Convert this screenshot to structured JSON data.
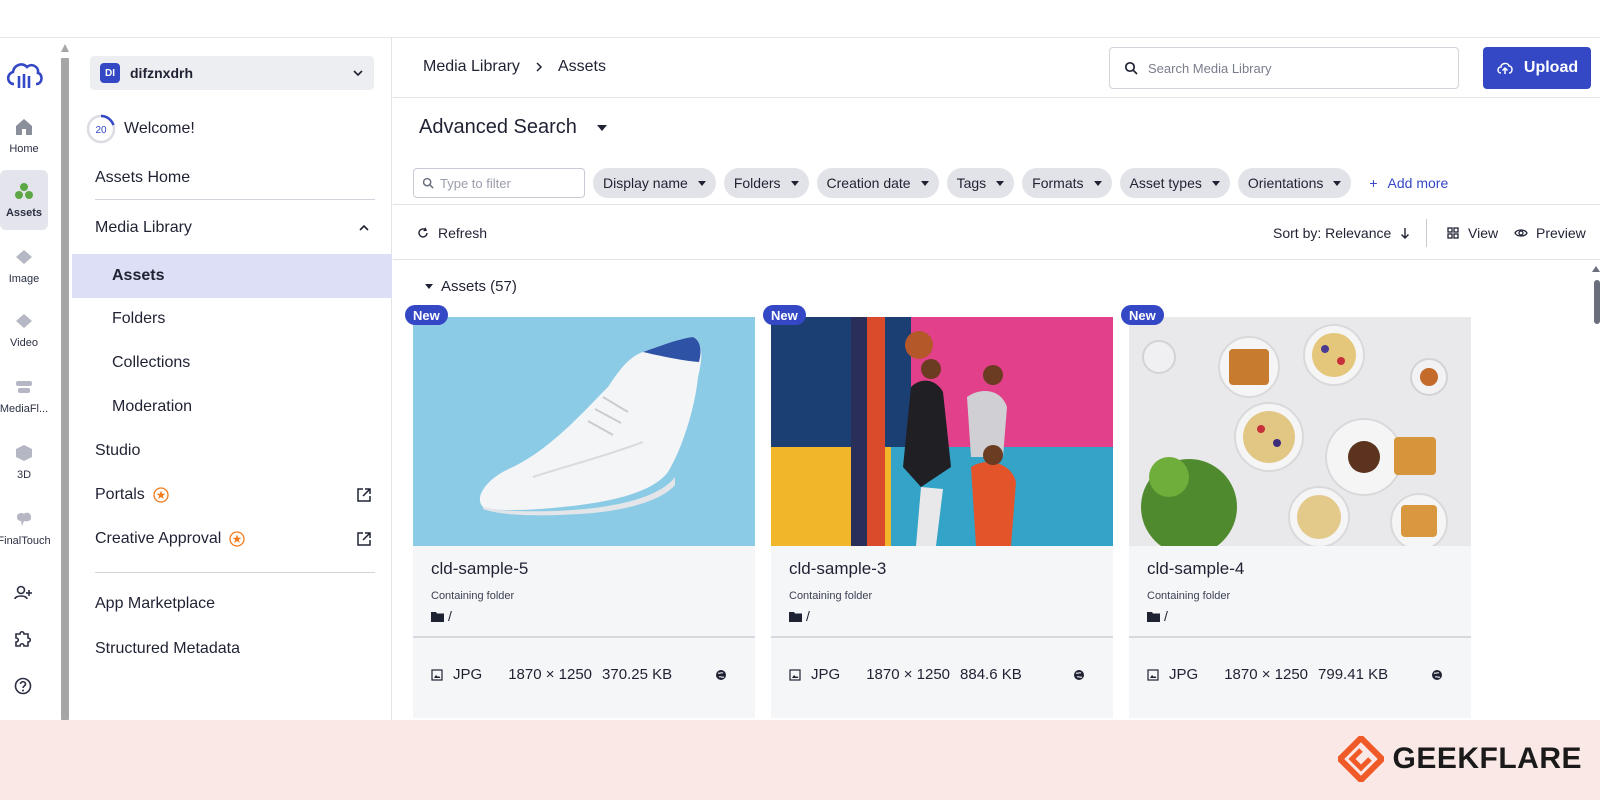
{
  "colors": {
    "accent": "#3448c5",
    "selected_bg": "#dcdff5",
    "portal_star": "#f07b1d",
    "footer_bg": "#f9e8e5"
  },
  "rail": {
    "items": [
      {
        "label": "Home",
        "icon": "home-icon"
      },
      {
        "label": "Assets",
        "icon": "assets-icon"
      },
      {
        "label": "Image",
        "icon": "image-icon"
      },
      {
        "label": "Video",
        "icon": "video-icon"
      },
      {
        "label": "MediaFl...",
        "icon": "mediaflows-icon"
      },
      {
        "label": "3D",
        "icon": "cube-icon"
      },
      {
        "label": "FinalTouch",
        "icon": "finaltouch-icon"
      }
    ]
  },
  "account": {
    "initials": "DI",
    "name": "difznxdrh"
  },
  "welcome": {
    "progress": "20",
    "label": "Welcome!"
  },
  "nav": {
    "assets_home": "Assets Home",
    "media_library": "Media Library",
    "assets": "Assets",
    "folders": "Folders",
    "collections": "Collections",
    "moderation": "Moderation",
    "studio": "Studio",
    "portals": "Portals",
    "creative_approval": "Creative Approval",
    "app_marketplace": "App Marketplace",
    "structured_metadata": "Structured Metadata"
  },
  "header": {
    "breadcrumb": [
      "Media Library",
      "Assets"
    ],
    "search_placeholder": "Search Media Library",
    "upload_label": "Upload"
  },
  "search_title": "Advanced Search",
  "filters": {
    "placeholder": "Type to filter",
    "chips": [
      "Display name",
      "Folders",
      "Creation date",
      "Tags",
      "Formats",
      "Asset types",
      "Orientations"
    ],
    "add_more": "Add more"
  },
  "toolbar": {
    "refresh": "Refresh",
    "sort": "Sort by: Relevance",
    "view": "View",
    "preview": "Preview"
  },
  "section": {
    "label": "Assets (57)"
  },
  "assets": [
    {
      "badge": "New",
      "name": "cld-sample-5",
      "folder_label": "Containing folder",
      "folder": "/",
      "format": "JPG",
      "dimensions": "1870 × 1250",
      "size": "370.25 KB"
    },
    {
      "badge": "New",
      "name": "cld-sample-3",
      "folder_label": "Containing folder",
      "folder": "/",
      "format": "JPG",
      "dimensions": "1870 × 1250",
      "size": "884.6 KB"
    },
    {
      "badge": "New",
      "name": "cld-sample-4",
      "folder_label": "Containing folder",
      "folder": "/",
      "format": "JPG",
      "dimensions": "1870 × 1250",
      "size": "799.41 KB"
    }
  ],
  "watermark": {
    "text": "GEEKFLARE"
  }
}
